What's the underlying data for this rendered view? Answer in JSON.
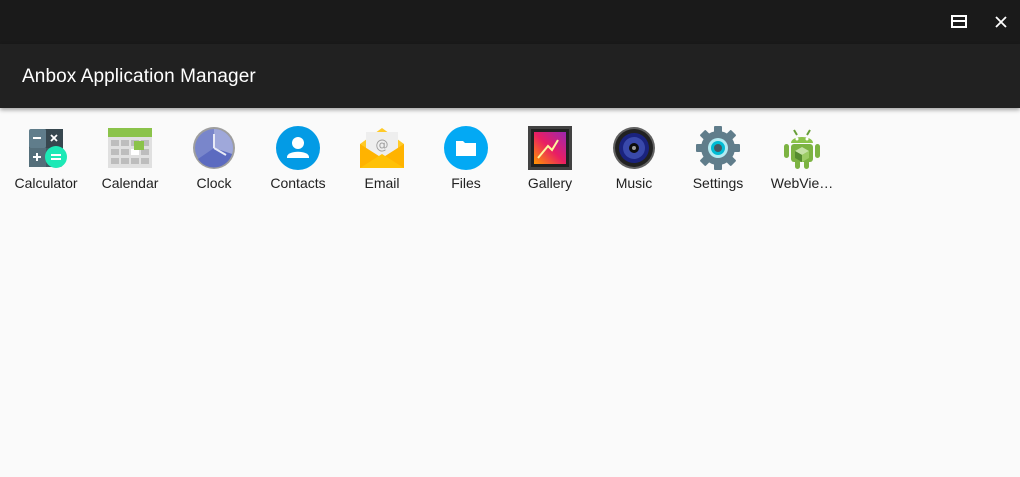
{
  "window": {
    "maximize_icon": "maximize-icon",
    "close_icon": "close-icon"
  },
  "appbar": {
    "title": "Anbox Application Manager",
    "background": "#212121"
  },
  "apps": [
    {
      "label": "Calculator",
      "icon": "calculator-icon"
    },
    {
      "label": "Calendar",
      "icon": "calendar-icon"
    },
    {
      "label": "Clock",
      "icon": "clock-icon"
    },
    {
      "label": "Contacts",
      "icon": "contacts-icon"
    },
    {
      "label": "Email",
      "icon": "email-icon"
    },
    {
      "label": "Files",
      "icon": "files-icon"
    },
    {
      "label": "Gallery",
      "icon": "gallery-icon"
    },
    {
      "label": "Music",
      "icon": "music-icon"
    },
    {
      "label": "Settings",
      "icon": "settings-icon"
    },
    {
      "label": "WebVie…",
      "icon": "android-icon"
    }
  ],
  "colors": {
    "titlebar": "#1a1a1a",
    "content_background": "#fafafa",
    "label_text": "#212121"
  }
}
